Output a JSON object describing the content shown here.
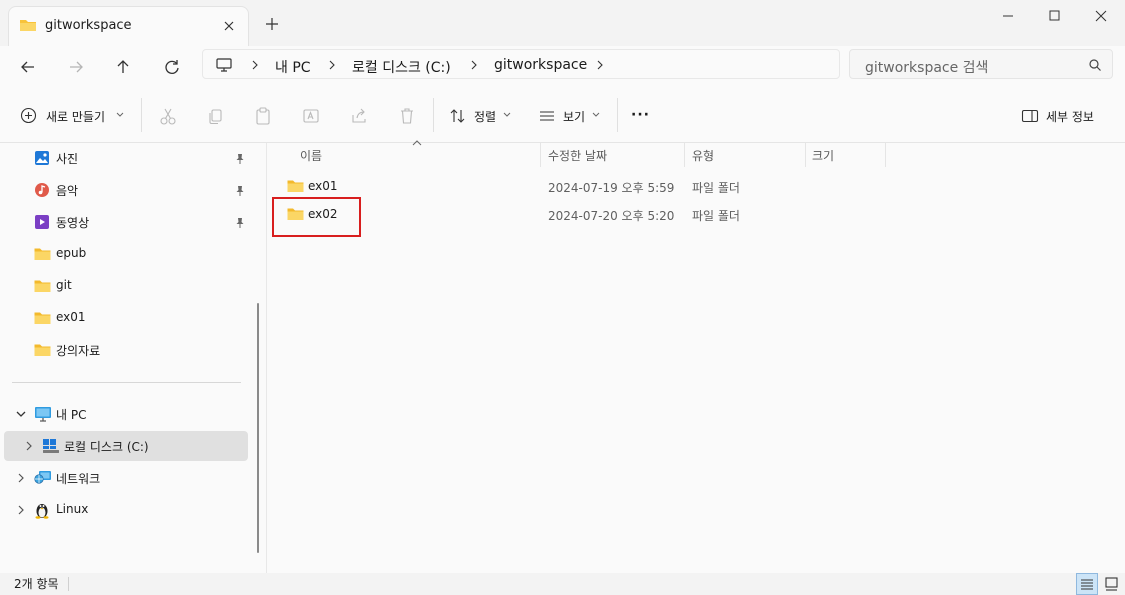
{
  "window": {
    "tab_title": "gitworkspace",
    "new_tab_symbol": "+",
    "icons": [
      "folder-icon",
      "close-icon",
      "minimize-icon",
      "maximize-icon",
      "window-close-icon"
    ]
  },
  "address": {
    "breadcrumbs": [
      "내 PC",
      "로컬 디스크 (C:)",
      "gitworkspace"
    ],
    "search_placeholder": "gitworkspace 검색"
  },
  "toolbar": {
    "new_label": "새로 만들기",
    "sort_label": "정렬",
    "view_label": "보기",
    "more_label": "···",
    "details_pane_label": "세부 정보"
  },
  "sidebar": {
    "pinned": [
      {
        "label": "사진",
        "icon": "photos-icon"
      },
      {
        "label": "음악",
        "icon": "music-icon"
      },
      {
        "label": "동영상",
        "icon": "video-icon"
      }
    ],
    "folders": [
      {
        "label": "epub"
      },
      {
        "label": "git"
      },
      {
        "label": "ex01"
      },
      {
        "label": "강의자료"
      }
    ],
    "tree": [
      {
        "label": "내 PC",
        "icon": "pc-icon",
        "expanded": true
      },
      {
        "label": "로컬 디스크 (C:)",
        "icon": "drive-icon",
        "selected": true
      },
      {
        "label": "네트워크",
        "icon": "network-icon"
      },
      {
        "label": "Linux",
        "icon": "linux-icon"
      }
    ]
  },
  "file_list": {
    "columns": [
      "이름",
      "수정한 날짜",
      "유형",
      "크기"
    ],
    "rows": [
      {
        "name": "ex01",
        "modified": "2024-07-19 오후 5:59",
        "type": "파일 폴더",
        "size": ""
      },
      {
        "name": "ex02",
        "modified": "2024-07-20 오후 5:20",
        "type": "파일 폴더",
        "size": ""
      }
    ],
    "highlight_color": "#d81e1e"
  },
  "status": {
    "item_count": "2개 항목"
  },
  "colors": {
    "accent": "#0067c0",
    "folder": "#f8c33a",
    "selection": "#e0e0e0"
  }
}
